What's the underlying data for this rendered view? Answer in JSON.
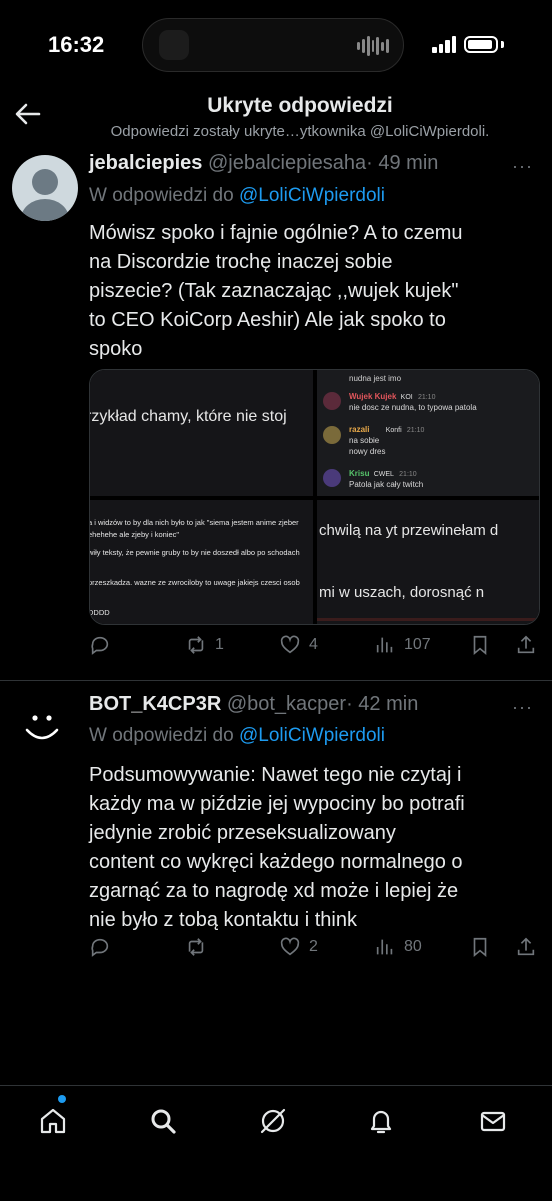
{
  "status_bar": {
    "time": "16:32"
  },
  "header": {
    "title": "Ukryte odpowiedzi",
    "subtitle": "Odpowiedzi zostały ukryte…ytkownika @LoliCiWpierdoli."
  },
  "tweets": [
    {
      "name": "jebalciepies",
      "handle": "@jebalciepiesaha",
      "time": "· 49 min",
      "reply_label": "W odpowiedzi do",
      "reply_to": "@LoliCiWpierdoli",
      "text_lines": [
        "Mówisz spoko i fajnie ogólnie? A to czemu",
        "na Discordzie trochę inaczej sobie",
        "piszecie? (Tak zaznaczając ,,wujek kujek\"",
        "to CEO KoiCorp Aeshir) Ale jak spoko to",
        "spoko"
      ],
      "media": {
        "top_left": "rzykład chamy, które nie stoj",
        "top_right": {
          "line0": "nudna jest imo",
          "msg1_name": "Wujek Kujek",
          "msg1_tag": "KOI",
          "msg1_time": "21:10",
          "msg1_text": "nie dosc ze nudna, to typowa patola",
          "msg2_name": "razali",
          "msg2_tag": "Konfi",
          "msg2_time": "21:10",
          "msg2_text1": "na sobie",
          "msg2_text2": "nowy dres",
          "msg3_name": "Krisu",
          "msg3_tag": "CWEL",
          "msg3_time": "21:10",
          "msg3_text": "Patola jak cały twitch"
        },
        "bottom_left": [
          "a i widzów to by dla nich było to jak \"siema jestem anime zjeber",
          "ehehehe ale zjeby i koniec\"",
          "wiły teksty, że pewnie gruby to by nie doszedł albo po schodach",
          "przeszkadza. wazne ze zwrociloby to uwage jakiejs czesci osob",
          "DDDD"
        ],
        "bottom_right": [
          "chwilą na yt przewinełam d",
          "mi w uszach, dorosnąć n"
        ]
      },
      "stats": {
        "replies": "",
        "reposts": "1",
        "likes": "4",
        "views": "107"
      }
    },
    {
      "name": "BOT_K4CP3R",
      "handle": "@bot_kacper",
      "time": "· 42 min",
      "reply_label": "W odpowiedzi do",
      "reply_to": "@LoliCiWpierdoli",
      "text_lines": [
        "Podsumowywanie: Nawet tego nie czytaj i",
        "każdy ma w piździe jej wypociny bo potrafi",
        "jedynie zrobić przeseksualizowany",
        "content co wykręci każdego normalnego o",
        "zgarnąć za to nagrodę xd może i lepiej że",
        "nie było z tobą kontaktu i think"
      ],
      "stats": {
        "replies": "",
        "reposts": "",
        "likes": "2",
        "views": "80"
      }
    }
  ],
  "colors": {
    "background": "#000000",
    "accent": "#1d9bf0",
    "muted": "#71767b",
    "text": "#e7e9ea",
    "divider": "#2f3336"
  },
  "icons": [
    "back-arrow-icon",
    "more-icon",
    "reply-icon",
    "repost-icon",
    "like-icon",
    "views-icon",
    "bookmark-icon",
    "share-icon",
    "home-icon",
    "search-icon",
    "grok-icon",
    "notifications-icon",
    "messages-icon"
  ]
}
